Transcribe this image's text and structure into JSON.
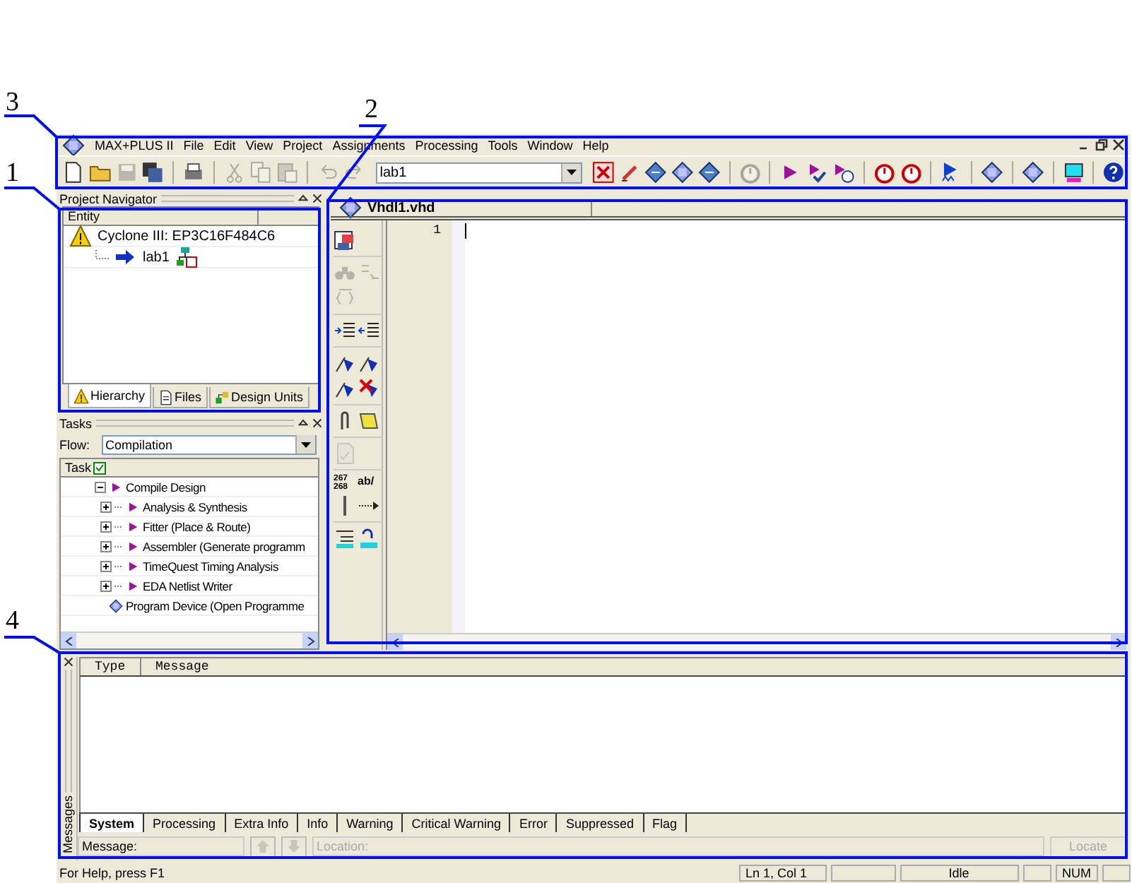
{
  "annotations": [
    {
      "label": "3"
    },
    {
      "label": "2"
    },
    {
      "label": "1"
    },
    {
      "label": "4"
    }
  ],
  "menu_bar": {
    "app_title": "MAX+PLUS II",
    "items": [
      "File",
      "Edit",
      "View",
      "Project",
      "Assignments",
      "Processing",
      "Tools",
      "Window",
      "Help"
    ]
  },
  "toolbar": {
    "entity_combo": "lab1",
    "buttons_left": [
      {
        "kind": "doc",
        "disabled": false
      },
      {
        "kind": "folder",
        "disabled": false
      },
      {
        "kind": "disk",
        "disabled": true
      },
      {
        "kind": "disks",
        "disabled": false
      },
      {
        "kind": "sep"
      },
      {
        "kind": "printer",
        "disabled": false
      },
      {
        "kind": "sep"
      },
      {
        "kind": "scissors",
        "disabled": true
      },
      {
        "kind": "copy",
        "disabled": true
      },
      {
        "kind": "paste",
        "disabled": true
      },
      {
        "kind": "sep"
      },
      {
        "kind": "undo",
        "disabled": true
      },
      {
        "kind": "redo",
        "disabled": true
      }
    ],
    "buttons_right": [
      {
        "kind": "stop",
        "disabled": false
      },
      {
        "kind": "pencil",
        "disabled": false
      },
      {
        "kind": "diamond",
        "disabled": false
      },
      {
        "kind": "chip",
        "disabled": false
      },
      {
        "kind": "diamond",
        "disabled": false
      },
      {
        "kind": "sep"
      },
      {
        "kind": "clock",
        "disabled": true
      },
      {
        "kind": "sep"
      },
      {
        "kind": "play",
        "disabled": false
      },
      {
        "kind": "check",
        "disabled": false
      },
      {
        "kind": "playclock",
        "disabled": false
      },
      {
        "kind": "sep"
      },
      {
        "kind": "clock",
        "disabled": false
      },
      {
        "kind": "clock",
        "disabled": false
      },
      {
        "kind": "sep"
      },
      {
        "kind": "wave",
        "disabled": false
      },
      {
        "kind": "sep"
      },
      {
        "kind": "chip",
        "disabled": false
      },
      {
        "kind": "sep"
      },
      {
        "kind": "chip",
        "disabled": false
      },
      {
        "kind": "sep"
      },
      {
        "kind": "screen",
        "disabled": false
      },
      {
        "kind": "sep"
      },
      {
        "kind": "help",
        "disabled": false
      }
    ]
  },
  "project_navigator": {
    "title": "Project Navigator",
    "column": "Entity",
    "items": [
      {
        "label": "Cyclone III: EP3C16F484C6",
        "kind": "device",
        "children": [
          {
            "label": "lab1",
            "kind": "entity"
          }
        ]
      }
    ],
    "tabs": [
      {
        "label": "Hierarchy",
        "kind": "warning",
        "selected": true
      },
      {
        "label": "Files",
        "kind": "file",
        "selected": false
      },
      {
        "label": "Design Units",
        "kind": "units",
        "selected": false
      }
    ]
  },
  "tasks": {
    "title": "Tasks",
    "flow_label": "Flow:",
    "flow": "Compilation",
    "column": "Task",
    "items": [
      {
        "label": "Compile Design",
        "kind": "play",
        "expanded": true,
        "children": [
          {
            "label": "Analysis & Synthesis",
            "kind": "play",
            "expanded": false
          },
          {
            "label": "Fitter (Place & Route)",
            "kind": "play",
            "expanded": false
          },
          {
            "label": "Assembler (Generate programm",
            "kind": "play",
            "expanded": false
          },
          {
            "label": "TimeQuest Timing Analysis",
            "kind": "play",
            "expanded": false
          },
          {
            "label": "EDA Netlist Writer",
            "kind": "play",
            "expanded": false
          }
        ]
      },
      {
        "label": "Program Device (Open Programme",
        "kind": "chip"
      }
    ]
  },
  "editor": {
    "tab": "Vhdl1.vhd",
    "line_numbers": [
      "1"
    ],
    "tools": [
      {
        "kind": "insert",
        "disabled": false
      },
      {
        "kind": "sep"
      },
      {
        "kind": "find",
        "disabled": true
      },
      {
        "kind": "replace",
        "disabled": true
      },
      {
        "kind": "braces",
        "disabled": true
      },
      {
        "kind": "sep"
      },
      {
        "kind": "indent",
        "disabled": false
      },
      {
        "kind": "outdent",
        "disabled": false
      },
      {
        "kind": "sep"
      },
      {
        "kind": "flag",
        "disabled": false
      },
      {
        "kind": "flag",
        "disabled": false
      },
      {
        "kind": "flag",
        "disabled": false
      },
      {
        "kind": "flagx",
        "disabled": false
      },
      {
        "kind": "sep"
      },
      {
        "kind": "clip",
        "disabled": false
      },
      {
        "kind": "scroll",
        "disabled": false
      },
      {
        "kind": "sep"
      },
      {
        "kind": "verify",
        "disabled": true
      },
      {
        "kind": "sep"
      },
      {
        "kind": "numbers",
        "text": "267",
        "text2": "268"
      },
      {
        "kind": "label",
        "text": "ab/"
      },
      {
        "kind": "vline",
        "disabled": false
      },
      {
        "kind": "arrow",
        "disabled": false
      },
      {
        "kind": "sep"
      },
      {
        "kind": "wrap",
        "disabled": false
      },
      {
        "kind": "unwrap",
        "disabled": false
      }
    ]
  },
  "messages": {
    "side_label": "Messages",
    "columns": [
      "Type",
      "Message"
    ],
    "tabs": [
      {
        "label": "System",
        "selected": true
      },
      {
        "label": "Processing",
        "selected": false
      },
      {
        "label": "Extra Info",
        "selected": false
      },
      {
        "label": "Info",
        "selected": false
      },
      {
        "label": "Warning",
        "selected": false
      },
      {
        "label": "Critical Warning",
        "selected": false
      },
      {
        "label": "Error",
        "selected": false
      },
      {
        "label": "Suppressed",
        "selected": false
      },
      {
        "label": "Flag",
        "selected": false
      }
    ],
    "message_label": "Message:",
    "location_placeholder": "Location:",
    "nav_buttons": [
      {
        "kind": "up",
        "disabled": true
      },
      {
        "kind": "down",
        "disabled": true
      }
    ],
    "locate_button": {
      "label": "Locate",
      "disabled": true
    }
  },
  "status_bar": {
    "help": "For Help, press F1",
    "position": "Ln 1, Col 1",
    "state": "Idle",
    "num": "NUM"
  }
}
